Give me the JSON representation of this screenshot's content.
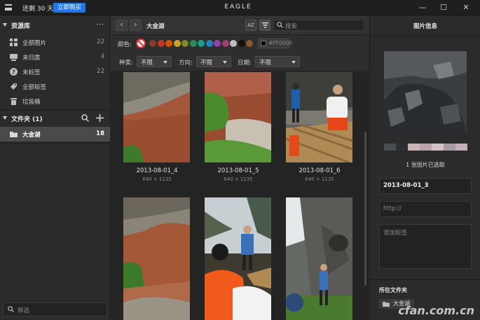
{
  "titlebar": {
    "trial_text": "还剩 30 天",
    "buy_label": "立即购买",
    "app_title": "EAGLE"
  },
  "sidebar": {
    "library_heading": "资源库",
    "items": [
      {
        "label": "全部图片",
        "count": "22",
        "icon": "images-icon"
      },
      {
        "label": "未归类",
        "count": "4",
        "icon": "unsorted-icon"
      },
      {
        "label": "未标签",
        "count": "22",
        "icon": "untagged-icon"
      },
      {
        "label": "全部标签",
        "count": "",
        "icon": "tag-icon"
      },
      {
        "label": "垃圾桶",
        "count": "",
        "icon": "trash-icon"
      }
    ],
    "folders_heading": "文件夹 (1)",
    "folders": [
      {
        "label": "大金湖",
        "count": "18"
      }
    ],
    "filter_placeholder": "筛选"
  },
  "toolbar": {
    "breadcrumb": "大金湖",
    "sort_label": "AZ",
    "search_placeholder": "搜索"
  },
  "filters": {
    "color_label": "颜色:",
    "hex_placeholder": "#FF0000",
    "colors": [
      "#8a3a2a",
      "#c0392b",
      "#d35400",
      "#c9a227",
      "#7f8c23",
      "#2e8b57",
      "#16a085",
      "#2980b9",
      "#8e44ad",
      "#a0406a",
      "#bdbdbd",
      "#111111",
      "#8b5a2b"
    ],
    "type_label": "种类:",
    "type_value": "不限",
    "orientation_label": "方向:",
    "orientation_value": "不限",
    "date_label": "日期:",
    "date_value": "不限"
  },
  "grid": {
    "items": [
      {
        "name": "2013-08-01_4",
        "dims": "640 × 1135"
      },
      {
        "name": "2013-08-01_5",
        "dims": "640 × 1135"
      },
      {
        "name": "2013-08-01_6",
        "dims": "640 × 1135"
      },
      {
        "name": "",
        "dims": ""
      },
      {
        "name": "",
        "dims": ""
      },
      {
        "name": "",
        "dims": ""
      }
    ]
  },
  "inspector": {
    "title": "图片信息",
    "palette": [
      "#4a4e52",
      "#2c2f33",
      "#c9b4b8",
      "#b9a6ad",
      "#d3c1c6",
      "#a89aa5",
      "#c3aebb"
    ],
    "selection_text": "1 张图片已选取",
    "name_value": "2013-08-01_3",
    "url_placeholder": "http://",
    "tags_placeholder": "添加标签",
    "folder_heading": "所在文件夹",
    "folder_chip": "大金湖"
  },
  "watermark": "cfan.com.cn"
}
